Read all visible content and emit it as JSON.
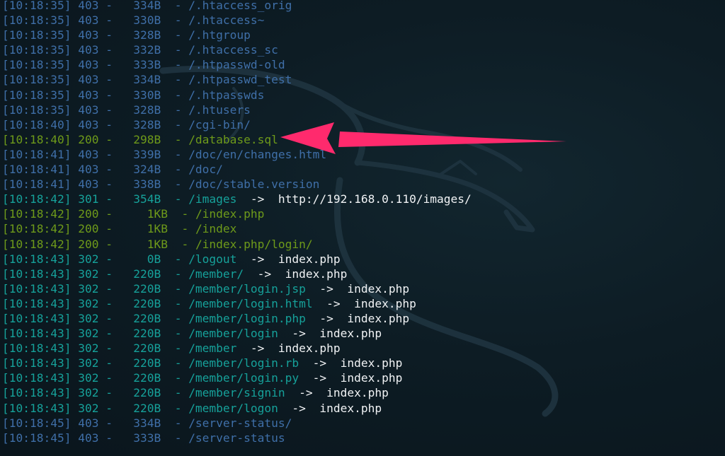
{
  "colors": {
    "background": "#0d1c24",
    "status_403": "#3f6fa8",
    "status_200": "#6e9a1a",
    "status_redirect": "#16a19a",
    "redirect_target": "#f1f3f5",
    "annotation_arrow": "#ff2a6d"
  },
  "icons": [
    "kali-dragon-watermark-icon",
    "highlight-arrow-icon"
  ],
  "lines": [
    {
      "time": "[10:18:35]",
      "status": "403",
      "size": "  334B",
      "path": "/.htaccess_orig"
    },
    {
      "time": "[10:18:35]",
      "status": "403",
      "size": "  330B",
      "path": "/.htaccess~"
    },
    {
      "time": "[10:18:35]",
      "status": "403",
      "size": "  328B",
      "path": "/.htgroup"
    },
    {
      "time": "[10:18:35]",
      "status": "403",
      "size": "  332B",
      "path": "/.htaccess_sc"
    },
    {
      "time": "[10:18:35]",
      "status": "403",
      "size": "  333B",
      "path": "/.htpasswd-old"
    },
    {
      "time": "[10:18:35]",
      "status": "403",
      "size": "  334B",
      "path": "/.htpasswd_test"
    },
    {
      "time": "[10:18:35]",
      "status": "403",
      "size": "  330B",
      "path": "/.htpasswds"
    },
    {
      "time": "[10:18:35]",
      "status": "403",
      "size": "  328B",
      "path": "/.htusers"
    },
    {
      "time": "[10:18:40]",
      "status": "403",
      "size": "  328B",
      "path": "/cgi-bin/"
    },
    {
      "time": "[10:18:40]",
      "status": "200",
      "size": "  298B",
      "path": "/database.sql"
    },
    {
      "time": "[10:18:41]",
      "status": "403",
      "size": "  339B",
      "path": "/doc/en/changes.html"
    },
    {
      "time": "[10:18:41]",
      "status": "403",
      "size": "  324B",
      "path": "/doc/"
    },
    {
      "time": "[10:18:41]",
      "status": "403",
      "size": "  338B",
      "path": "/doc/stable.version"
    },
    {
      "time": "[10:18:42]",
      "status": "301",
      "size": "  354B",
      "path": "/images",
      "redirect": "http://192.168.0.110/images/"
    },
    {
      "time": "[10:18:42]",
      "status": "200",
      "size": "    1KB",
      "path": "/index.php"
    },
    {
      "time": "[10:18:42]",
      "status": "200",
      "size": "    1KB",
      "path": "/index"
    },
    {
      "time": "[10:18:42]",
      "status": "200",
      "size": "    1KB",
      "path": "/index.php/login/"
    },
    {
      "time": "[10:18:43]",
      "status": "302",
      "size": "    0B",
      "path": "/logout",
      "redirect": "index.php"
    },
    {
      "time": "[10:18:43]",
      "status": "302",
      "size": "  220B",
      "path": "/member/",
      "redirect": "index.php"
    },
    {
      "time": "[10:18:43]",
      "status": "302",
      "size": "  220B",
      "path": "/member/login.jsp",
      "redirect": "index.php"
    },
    {
      "time": "[10:18:43]",
      "status": "302",
      "size": "  220B",
      "path": "/member/login.html",
      "redirect": "index.php"
    },
    {
      "time": "[10:18:43]",
      "status": "302",
      "size": "  220B",
      "path": "/member/login.php",
      "redirect": "index.php"
    },
    {
      "time": "[10:18:43]",
      "status": "302",
      "size": "  220B",
      "path": "/member/login",
      "redirect": "index.php"
    },
    {
      "time": "[10:18:43]",
      "status": "302",
      "size": "  220B",
      "path": "/member",
      "redirect": "index.php"
    },
    {
      "time": "[10:18:43]",
      "status": "302",
      "size": "  220B",
      "path": "/member/login.rb",
      "redirect": "index.php"
    },
    {
      "time": "[10:18:43]",
      "status": "302",
      "size": "  220B",
      "path": "/member/login.py",
      "redirect": "index.php"
    },
    {
      "time": "[10:18:43]",
      "status": "302",
      "size": "  220B",
      "path": "/member/signin",
      "redirect": "index.php"
    },
    {
      "time": "[10:18:43]",
      "status": "302",
      "size": "  220B",
      "path": "/member/logon",
      "redirect": "index.php"
    },
    {
      "time": "[10:18:45]",
      "status": "403",
      "size": "  334B",
      "path": "/server-status/"
    },
    {
      "time": "[10:18:45]",
      "status": "403",
      "size": "  333B",
      "path": "/server-status"
    }
  ]
}
